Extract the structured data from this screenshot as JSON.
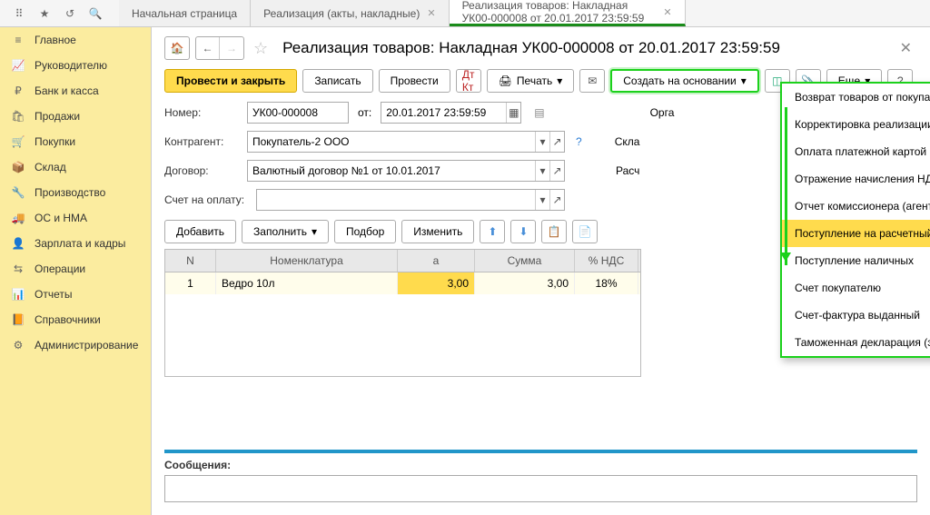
{
  "titlebar": {
    "tabs": [
      {
        "label": "Начальная страница"
      },
      {
        "label": "Реализация (акты, накладные)"
      },
      {
        "label": "Реализация товаров: Накладная УК00-000008 от 20.01.2017 23:59:59"
      }
    ]
  },
  "sidebar": {
    "items": [
      {
        "label": "Главное",
        "icon": "≡"
      },
      {
        "label": "Руководителю",
        "icon": "📈"
      },
      {
        "label": "Банк и касса",
        "icon": "₽"
      },
      {
        "label": "Продажи",
        "icon": "🛍"
      },
      {
        "label": "Покупки",
        "icon": "🛒"
      },
      {
        "label": "Склад",
        "icon": "📦"
      },
      {
        "label": "Производство",
        "icon": "🔧"
      },
      {
        "label": "ОС и НМА",
        "icon": "🚚"
      },
      {
        "label": "Зарплата и кадры",
        "icon": "👤"
      },
      {
        "label": "Операции",
        "icon": "⇆"
      },
      {
        "label": "Отчеты",
        "icon": "📊"
      },
      {
        "label": "Справочники",
        "icon": "📙"
      },
      {
        "label": "Администрирование",
        "icon": "⚙"
      }
    ]
  },
  "page": {
    "title": "Реализация товаров: Накладная УК00-000008 от 20.01.2017 23:59:59",
    "toolbar": {
      "post_close": "Провести и закрыть",
      "write": "Записать",
      "post": "Провести",
      "print": "Печать",
      "create_based": "Создать на основании",
      "more": "Еще"
    },
    "form": {
      "number_label": "Номер:",
      "number": "УК00-000008",
      "from_label": "от:",
      "date": "20.01.2017 23:59:59",
      "org_label": "Орга",
      "counterparty_label": "Контрагент:",
      "counterparty": "Покупатель-2 ООО",
      "warehouse_label": "Скла",
      "contract_label": "Договор:",
      "contract": "Валютный договор №1 от 10.01.2017",
      "calc_label": "Расч",
      "invoice_label": "Счет на оплату:"
    },
    "table_toolbar": {
      "add": "Добавить",
      "fill": "Заполнить",
      "select": "Подбор",
      "change": "Изменить"
    },
    "grid": {
      "headers": {
        "n": "N",
        "nom": "Номенклатура",
        "qty": "а",
        "sum": "Сумма",
        "vat": "% НДС"
      },
      "rows": [
        {
          "n": "1",
          "nom": "Ведро 10л",
          "qty": "3,00",
          "sum": "3,00",
          "vat": "18%"
        }
      ]
    },
    "dropdown": {
      "items": [
        "Возврат товаров от покупателя",
        "Корректировка реализации",
        "Оплата платежной картой",
        "Отражение начисления НДС",
        "Отчет комиссионера (агента) о продажах",
        "Поступление на расчетный счет",
        "Поступление наличных",
        "Счет покупателю",
        "Счет-фактура выданный",
        "Таможенная декларация (экспорт)"
      ],
      "selected_index": 5
    },
    "messages": {
      "title": "Сообщения:"
    }
  }
}
